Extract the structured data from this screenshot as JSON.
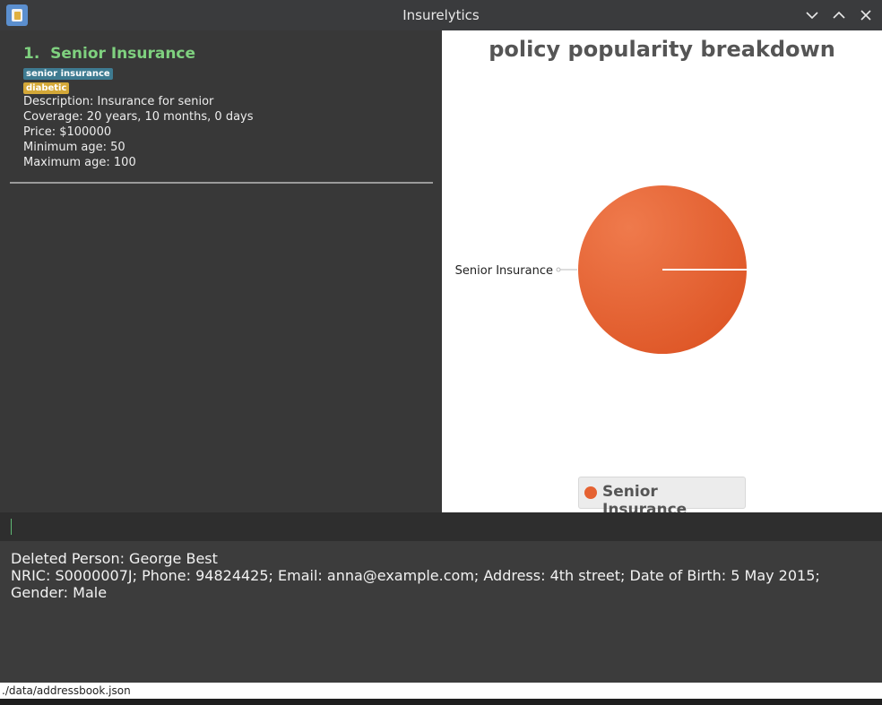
{
  "window": {
    "title": "Insurelytics",
    "icon": "app-logo-icon"
  },
  "policy_list": {
    "items": [
      {
        "index": "1.",
        "name": "Senior Insurance",
        "tags": [
          {
            "label": "senior insurance",
            "color": "#3e7b91"
          },
          {
            "label": "diabetic",
            "color": "#d4a838"
          }
        ],
        "description": "Description: Insurance for senior",
        "coverage": "Coverage: 20 years, 10 months, 0 days",
        "price": "Price: $100000",
        "min_age": "Minimum age: 50",
        "max_age": "Maximum age: 100"
      }
    ]
  },
  "chart": {
    "title": "policy popularity breakdown",
    "slice_label": "Senior Insurance",
    "legend_label": "Senior Insurance"
  },
  "chart_data": {
    "type": "pie",
    "title": "policy popularity breakdown",
    "categories": [
      "Senior Insurance"
    ],
    "values": [
      1
    ],
    "colors": [
      "#e56232"
    ],
    "legend_position": "bottom"
  },
  "command_box": {
    "value": "",
    "placeholder": ""
  },
  "result_display": {
    "line1": "Deleted Person: George Best",
    "line2": "NRIC: S0000007J; Phone: 94824425; Email: anna@example.com; Address: 4th street; Date of Birth: 5 May 2015; Gender: Male"
  },
  "status_bar": {
    "path": "./data/addressbook.json"
  },
  "colors": {
    "accent": "#7fd17f",
    "slice": "#e56232",
    "tag_blue": "#3e7b91",
    "tag_yellow": "#d4a838"
  }
}
